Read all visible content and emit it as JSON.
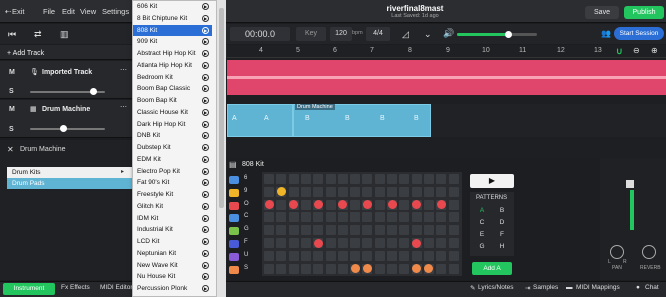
{
  "topbar": {
    "back_icon": "back-icon",
    "exit_label": "Exit",
    "menu": [
      "File",
      "Edit",
      "View",
      "Settings"
    ],
    "project_title": "riverfinal8mast",
    "saved_status": "Last Saved: 1d ago",
    "save_label": "Save",
    "publish_label": "Publish"
  },
  "transport": {
    "time": "00:00.0",
    "key_label": "Key",
    "tempo": "120",
    "tempo_unit": "bpm",
    "time_signature": "4/4",
    "start_session_label": "Start Session"
  },
  "ruler": {
    "numbers": [
      "4",
      "5",
      "6",
      "7",
      "8",
      "9",
      "10",
      "11",
      "12",
      "13"
    ]
  },
  "tracks": {
    "add_label": "+ Add Track",
    "track1": {
      "mute": "M",
      "solo": "S",
      "name": "Imported Track"
    },
    "track2": {
      "mute": "M",
      "solo": "S",
      "name": "Drum Machine"
    }
  },
  "clips": {
    "label": "Drum Machine",
    "cells": [
      "A",
      "A",
      "B",
      "B",
      "B",
      "B"
    ]
  },
  "instrument_panel": {
    "title": "Drum Machine",
    "rows": [
      "Drum Kits",
      "Drum Pads"
    ]
  },
  "dropdown": {
    "items": [
      "606 Kit",
      "8 Bit Chiptune Kit",
      "808 Kit",
      "909 Kit",
      "Abstract Hip Hop Kit",
      "Atlanta Hip Hop Kit",
      "Bedroom Kit",
      "Boom Bap Classic",
      "Boom Bap Kit",
      "Classic House Kit",
      "Dark Hip Hop Kit",
      "DNB Kit",
      "Dubstep Kit",
      "EDM Kit",
      "Electro Pop Kit",
      "Fat 90's Kit",
      "Freestyle Kit",
      "Glitch Kit",
      "IDM Kit",
      "Industrial Kit",
      "LCD Kit",
      "Neptunian Kit",
      "New Wave Kit",
      "Nu House Kit",
      "Percussion Plonk"
    ],
    "selected": "808 Kit"
  },
  "drum_machine": {
    "kit_title": "808 Kit",
    "row_values": [
      "6",
      "9",
      "O",
      "C",
      "G",
      "F",
      "U",
      "S"
    ],
    "patterns_label": "PATTERNS",
    "patterns": [
      "A",
      "B",
      "C",
      "D",
      "E",
      "F",
      "G",
      "H"
    ],
    "add_label": "Add A",
    "mixer": {
      "l": "L",
      "r": "R",
      "pan": "PAN",
      "reverb": "REVERB"
    }
  },
  "bottombar": {
    "tabs": [
      "Instrument",
      "Fx Effects",
      "MIDI Editor"
    ],
    "right": [
      "Lyrics/Notes",
      "Samples",
      "MIDI Mappings",
      "Chat"
    ]
  },
  "colors": {
    "accent": "#22c55e",
    "track1": "#e0466b",
    "clip": "#5fb4d4",
    "selected": "#2b6fd6"
  }
}
